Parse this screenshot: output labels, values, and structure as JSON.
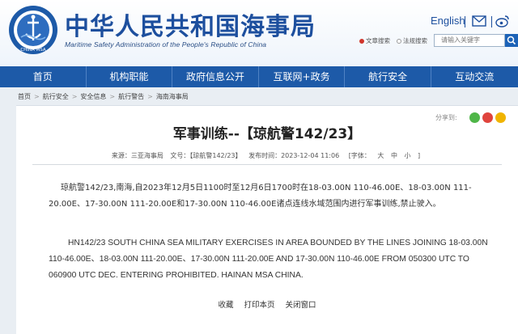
{
  "header": {
    "title_cn": "中华人民共和国海事局",
    "title_en": "Maritime Safety Administration of the People's Republic of China",
    "logo_text": "CHINA MSA",
    "lang_link": "English",
    "search_options": [
      "文章搜索",
      "法规搜索"
    ],
    "search_placeholder": "请输入关键字"
  },
  "nav": {
    "items": [
      "首页",
      "机构职能",
      "政府信息公开",
      "互联网+政务",
      "航行安全",
      "互动交流"
    ]
  },
  "breadcrumb": [
    "首页",
    "航行安全",
    "安全信息",
    "航行警告",
    "海南海事局"
  ],
  "article": {
    "share_label": "分享到:",
    "title": "军事训练--【琼航警142/23】",
    "meta_source": "来源：三亚海事局",
    "meta_docno": "文号：【琼航警142/23】",
    "meta_time": "发布时间：2023-12-04 11:06",
    "meta_font_label": "[字体：",
    "meta_font_large": "大",
    "meta_font_medium": "中",
    "meta_font_small": "小",
    "meta_font_end": "]",
    "para_cn": "琼航警142/23,南海,自2023年12月5日1100时至12月6日1700时在18-03.00N 110-46.00E、18-03.00N 111-20.00E、17-30.00N 111-20.00E和17-30.00N 110-46.00E诸点连线水域范围内进行军事训练,禁止驶入。",
    "para_en": "HN142/23 SOUTH CHINA SEA MILITARY EXERCISES IN AREA BOUNDED BY THE LINES JOINING 18-03.00N 110-46.00E、18-03.00N 111-20.00E、17-30.00N 111-20.00E AND 17-30.00N 110-46.00E FROM 050300 UTC TO 060900 UTC DEC. ENTERING PROHIBITED. HAINAN MSA CHINA.",
    "actions": [
      "收藏",
      "打印本页",
      "关闭窗口"
    ]
  },
  "colors": {
    "brand_blue": "#1d5aa8",
    "title_blue": "#1d4f9e",
    "wechat": "#4fb648",
    "weibo": "#e0443d",
    "qzone": "#f0b400"
  }
}
